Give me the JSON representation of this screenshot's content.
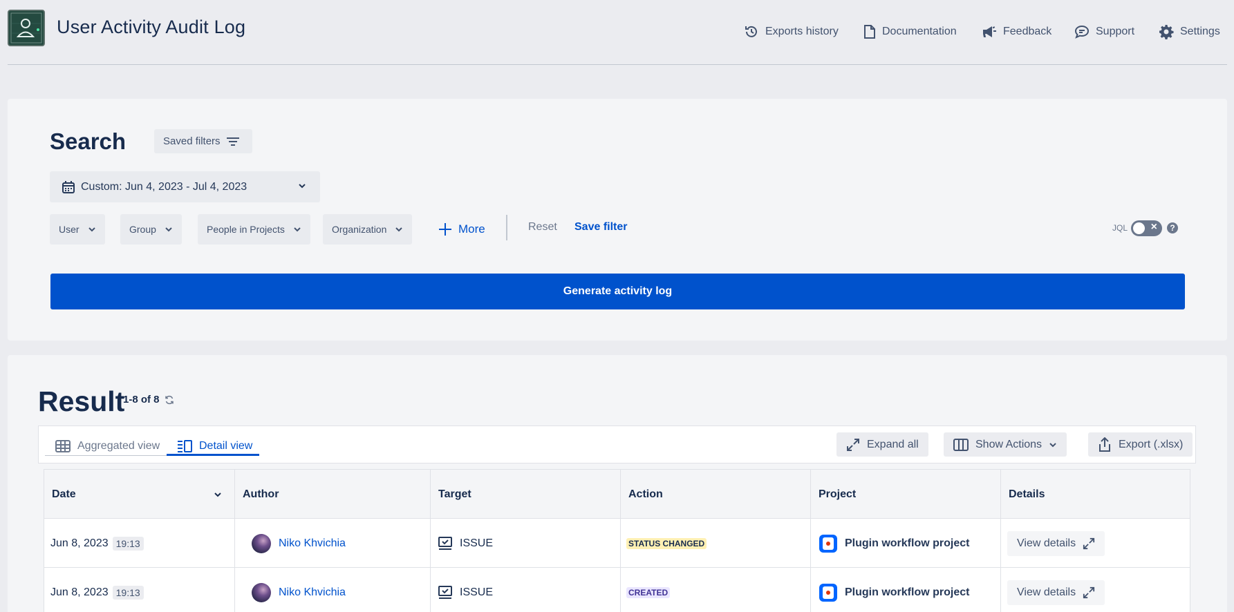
{
  "header": {
    "title": "User Activity Audit Log",
    "nav": [
      {
        "label": "Exports history",
        "icon": "history-icon"
      },
      {
        "label": "Documentation",
        "icon": "document-icon"
      },
      {
        "label": "Feedback",
        "icon": "megaphone-icon"
      },
      {
        "label": "Support",
        "icon": "chat-icon"
      },
      {
        "label": "Settings",
        "icon": "gear-icon"
      }
    ]
  },
  "search": {
    "title": "Search",
    "saved_filters_label": "Saved filters",
    "date_range": "Custom: Jun 4, 2023 - Jul 4, 2023",
    "filters": [
      "User",
      "Group",
      "People in Projects",
      "Organization"
    ],
    "more_label": "More",
    "reset_label": "Reset",
    "save_filter_label": "Save filter",
    "jql_label": "JQL",
    "jql_enabled": false,
    "generate_label": "Generate activity log"
  },
  "result": {
    "title": "Result",
    "count": "1-8 of 8",
    "tabs": [
      {
        "label": "Aggregated view",
        "active": false
      },
      {
        "label": "Detail view",
        "active": true
      }
    ],
    "expand_all_label": "Expand all",
    "show_actions_label": "Show Actions",
    "export_label": "Export (.xlsx)",
    "columns": [
      "Date",
      "Author",
      "Target",
      "Action",
      "Project",
      "Details"
    ],
    "rows": [
      {
        "date": "Jun 8, 2023",
        "time": "19:13",
        "author": "Niko Khvichia",
        "target": "ISSUE",
        "action": "STATUS CHANGED",
        "action_bg": "#fff0b3",
        "action_color": "#172b4d",
        "project": "Plugin workflow project",
        "details": "View details"
      },
      {
        "date": "Jun 8, 2023",
        "time": "19:13",
        "author": "Niko Khvichia",
        "target": "ISSUE",
        "action": "CREATED",
        "action_bg": "#eae6ff",
        "action_color": "#403294",
        "project": "Plugin workflow project",
        "details": "View details"
      }
    ]
  },
  "colors": {
    "primary": "#0052cc",
    "background": "#ebecf0",
    "panel": "#f4f5f7",
    "text": "#172b4d"
  }
}
